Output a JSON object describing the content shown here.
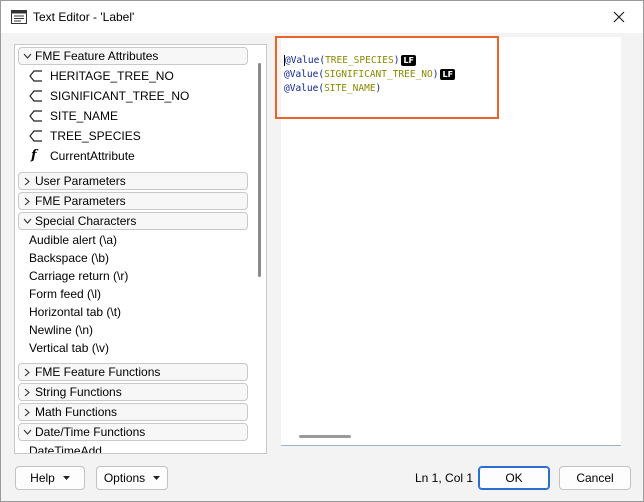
{
  "window": {
    "title": "Text Editor - 'Label'"
  },
  "tree": {
    "sections": [
      {
        "label": "FME Feature Attributes",
        "expanded": true
      },
      {
        "label": "User Parameters",
        "expanded": false
      },
      {
        "label": "FME Parameters",
        "expanded": false
      },
      {
        "label": "Special Characters",
        "expanded": true
      },
      {
        "label": "FME Feature Functions",
        "expanded": false
      },
      {
        "label": "String Functions",
        "expanded": false
      },
      {
        "label": "Math Functions",
        "expanded": false
      },
      {
        "label": "Date/Time Functions",
        "expanded": true
      }
    ],
    "attributes": [
      "HERITAGE_TREE_NO",
      "SIGNIFICANT_TREE_NO",
      "SITE_NAME",
      "TREE_SPECIES"
    ],
    "current_attribute": "CurrentAttribute",
    "special_characters": [
      "Audible alert (\\a)",
      "Backspace (\\b)",
      "Carriage return (\\r)",
      "Form feed (\\l)",
      "Horizontal tab (\\t)",
      "Newline (\\n)",
      "Vertical tab (\\v)"
    ],
    "datetime_functions": [
      "DateTimeAdd"
    ]
  },
  "editor": {
    "lines": [
      {
        "func": "@Value",
        "arg": "TREE_SPECIES",
        "lf": "LF"
      },
      {
        "func": "@Value",
        "arg": "SIGNIFICANT_TREE_NO",
        "lf": "LF"
      },
      {
        "func": "@Value",
        "arg": "SITE_NAME",
        "lf": ""
      }
    ]
  },
  "footer": {
    "help_label": "Help",
    "options_label": "Options",
    "status": "Ln 1, Col 1",
    "ok_label": "OK",
    "cancel_label": "Cancel"
  },
  "colors": {
    "highlight": "#e8642a",
    "function": "#0b1f8c",
    "argument": "#8a8a00",
    "primary_border": "#2a6fc9"
  }
}
